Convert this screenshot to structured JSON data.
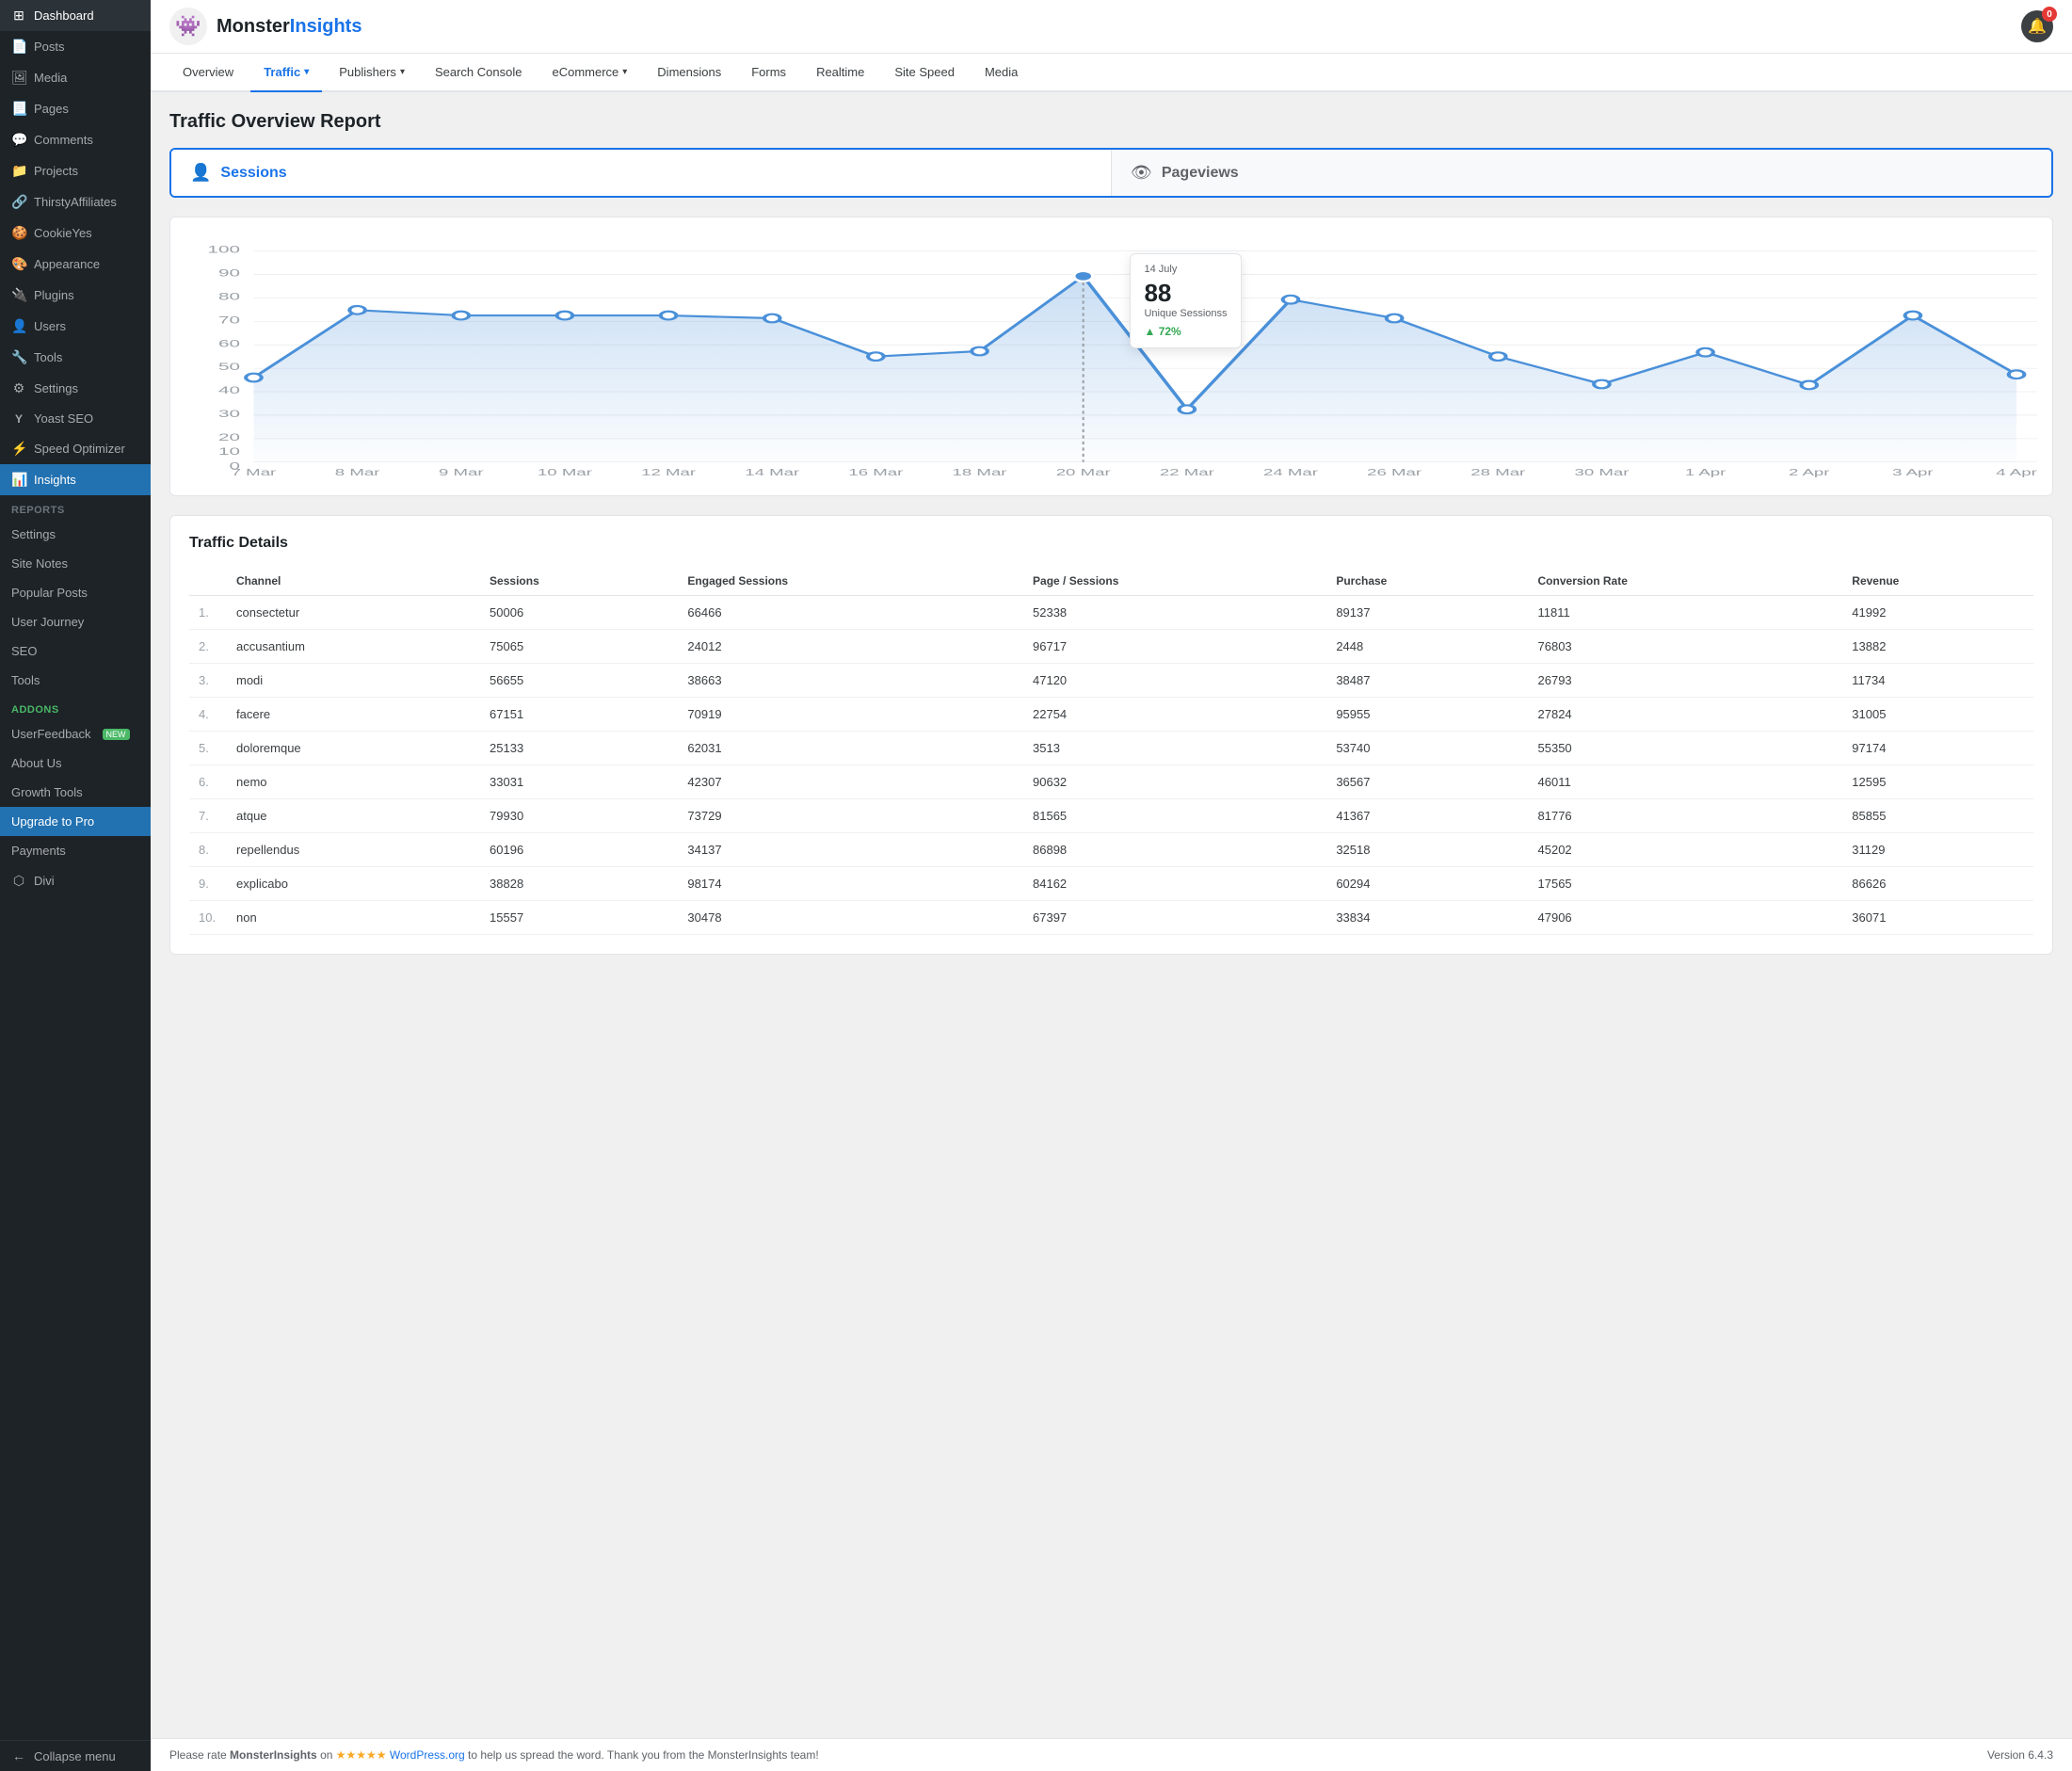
{
  "brand": {
    "name_start": "Monster",
    "name_end": "Insights",
    "notification_count": "0"
  },
  "sidebar": {
    "top_items": [
      {
        "id": "dashboard",
        "label": "Dashboard",
        "icon": "⊞"
      },
      {
        "id": "posts",
        "label": "Posts",
        "icon": "📄"
      },
      {
        "id": "media",
        "label": "Media",
        "icon": "🖼"
      },
      {
        "id": "pages",
        "label": "Pages",
        "icon": "📃"
      },
      {
        "id": "comments",
        "label": "Comments",
        "icon": "💬"
      },
      {
        "id": "projects",
        "label": "Projects",
        "icon": "📁"
      },
      {
        "id": "thirsty",
        "label": "ThirstyAffiliates",
        "icon": "🔗"
      },
      {
        "id": "cookieyes",
        "label": "CookieYes",
        "icon": "🍪"
      },
      {
        "id": "appearance",
        "label": "Appearance",
        "icon": "🎨"
      },
      {
        "id": "plugins",
        "label": "Plugins",
        "icon": "🔌"
      },
      {
        "id": "users",
        "label": "Users",
        "icon": "👤"
      },
      {
        "id": "tools",
        "label": "Tools",
        "icon": "🔧"
      },
      {
        "id": "settings",
        "label": "Settings",
        "icon": "⚙"
      },
      {
        "id": "yoast",
        "label": "Yoast SEO",
        "icon": "Y"
      },
      {
        "id": "speed",
        "label": "Speed Optimizer",
        "icon": "⚡"
      },
      {
        "id": "insights",
        "label": "Insights",
        "icon": "📊",
        "active": true
      }
    ],
    "reports_section": "Reports",
    "reports_items": [
      {
        "id": "settings",
        "label": "Settings"
      },
      {
        "id": "site-notes",
        "label": "Site Notes"
      },
      {
        "id": "popular-posts",
        "label": "Popular Posts"
      },
      {
        "id": "user-journey",
        "label": "User Journey"
      },
      {
        "id": "seo",
        "label": "SEO"
      }
    ],
    "tools_label": "Tools",
    "addons_label": "Addons",
    "addons_items": [
      {
        "id": "userfeedback",
        "label": "UserFeedback",
        "badge": "NEW"
      },
      {
        "id": "about-us",
        "label": "About Us"
      },
      {
        "id": "growth-tools",
        "label": "Growth Tools"
      }
    ],
    "upgrade_label": "Upgrade to Pro",
    "payments_label": "Payments",
    "divi_label": "Divi",
    "collapse_label": "Collapse menu"
  },
  "nav_tabs": [
    {
      "id": "overview",
      "label": "Overview",
      "active": false,
      "dropdown": false
    },
    {
      "id": "traffic",
      "label": "Traffic",
      "active": true,
      "dropdown": true
    },
    {
      "id": "publishers",
      "label": "Publishers",
      "active": false,
      "dropdown": true
    },
    {
      "id": "search-console",
      "label": "Search Console",
      "active": false,
      "dropdown": false
    },
    {
      "id": "ecommerce",
      "label": "eCommerce",
      "active": false,
      "dropdown": true
    },
    {
      "id": "dimensions",
      "label": "Dimensions",
      "active": false,
      "dropdown": false
    },
    {
      "id": "forms",
      "label": "Forms",
      "active": false,
      "dropdown": false
    },
    {
      "id": "realtime",
      "label": "Realtime",
      "active": false,
      "dropdown": false
    },
    {
      "id": "site-speed",
      "label": "Site Speed",
      "active": false,
      "dropdown": false
    },
    {
      "id": "media",
      "label": "Media",
      "active": false,
      "dropdown": false
    }
  ],
  "page_title": "Traffic Overview Report",
  "metrics": {
    "sessions": {
      "label": "Sessions",
      "icon": "👤",
      "active": true
    },
    "pageviews": {
      "label": "Pageviews",
      "icon": "👁",
      "active": false
    }
  },
  "tooltip": {
    "date": "14 July",
    "value": "88",
    "label": "Unique Sessionss",
    "change": "72%"
  },
  "chart": {
    "x_labels": [
      "7 Mar",
      "8 Mar",
      "9 Mar",
      "10 Mar",
      "12 Mar",
      "14 Mar",
      "16 Mar",
      "18 Mar",
      "20 Mar",
      "22 Mar",
      "24 Mar",
      "26 Mar",
      "28 Mar",
      "30 Mar",
      "1 Apr",
      "2 Apr",
      "3 Apr",
      "4 Apr"
    ],
    "y_labels": [
      "0",
      "10",
      "20",
      "30",
      "40",
      "50",
      "60",
      "70",
      "80",
      "90",
      "100"
    ],
    "data_points": [
      40,
      72,
      68,
      68,
      68,
      65,
      50,
      53,
      88,
      25,
      77,
      65,
      50,
      37,
      52,
      36,
      68,
      42
    ]
  },
  "traffic_details": {
    "title": "Traffic Details",
    "columns": [
      "Channel",
      "Sessions",
      "Engaged Sessions",
      "Page / Sessions",
      "Purchase",
      "Conversion Rate",
      "Revenue"
    ],
    "rows": [
      {
        "num": "1.",
        "channel": "consectetur",
        "sessions": "50006",
        "engaged": "66466",
        "page_sessions": "52338",
        "purchase": "89137",
        "conv_rate": "11811",
        "revenue": "41992"
      },
      {
        "num": "2.",
        "channel": "accusantium",
        "sessions": "75065",
        "engaged": "24012",
        "page_sessions": "96717",
        "purchase": "2448",
        "conv_rate": "76803",
        "revenue": "13882"
      },
      {
        "num": "3.",
        "channel": "modi",
        "sessions": "56655",
        "engaged": "38663",
        "page_sessions": "47120",
        "purchase": "38487",
        "conv_rate": "26793",
        "revenue": "11734"
      },
      {
        "num": "4.",
        "channel": "facere",
        "sessions": "67151",
        "engaged": "70919",
        "page_sessions": "22754",
        "purchase": "95955",
        "conv_rate": "27824",
        "revenue": "31005"
      },
      {
        "num": "5.",
        "channel": "doloremque",
        "sessions": "25133",
        "engaged": "62031",
        "page_sessions": "3513",
        "purchase": "53740",
        "conv_rate": "55350",
        "revenue": "97174"
      },
      {
        "num": "6.",
        "channel": "nemo",
        "sessions": "33031",
        "engaged": "42307",
        "page_sessions": "90632",
        "purchase": "36567",
        "conv_rate": "46011",
        "revenue": "12595"
      },
      {
        "num": "7.",
        "channel": "atque",
        "sessions": "79930",
        "engaged": "73729",
        "page_sessions": "81565",
        "purchase": "41367",
        "conv_rate": "81776",
        "revenue": "85855"
      },
      {
        "num": "8.",
        "channel": "repellendus",
        "sessions": "60196",
        "engaged": "34137",
        "page_sessions": "86898",
        "purchase": "32518",
        "conv_rate": "45202",
        "revenue": "31129"
      },
      {
        "num": "9.",
        "channel": "explicabo",
        "sessions": "38828",
        "engaged": "98174",
        "page_sessions": "84162",
        "purchase": "60294",
        "conv_rate": "17565",
        "revenue": "86626"
      },
      {
        "num": "10.",
        "channel": "non",
        "sessions": "15557",
        "engaged": "30478",
        "page_sessions": "67397",
        "purchase": "33834",
        "conv_rate": "47906",
        "revenue": "36071"
      }
    ]
  },
  "footer": {
    "text_start": "Please rate ",
    "brand": "MonsterInsights",
    "text_middle": " on ",
    "link_label": "WordPress.org",
    "link_url": "#",
    "text_end": " to help us spread the word. Thank you from the MonsterInsights team!",
    "version": "Version 6.4.3",
    "stars": "★★★★★"
  },
  "colors": {
    "accent": "#1a73e8",
    "sidebar_active": "#2271b1",
    "positive": "#34a853",
    "chart_line": "#4a90d9",
    "chart_fill": "rgba(74,144,217,0.15)"
  }
}
